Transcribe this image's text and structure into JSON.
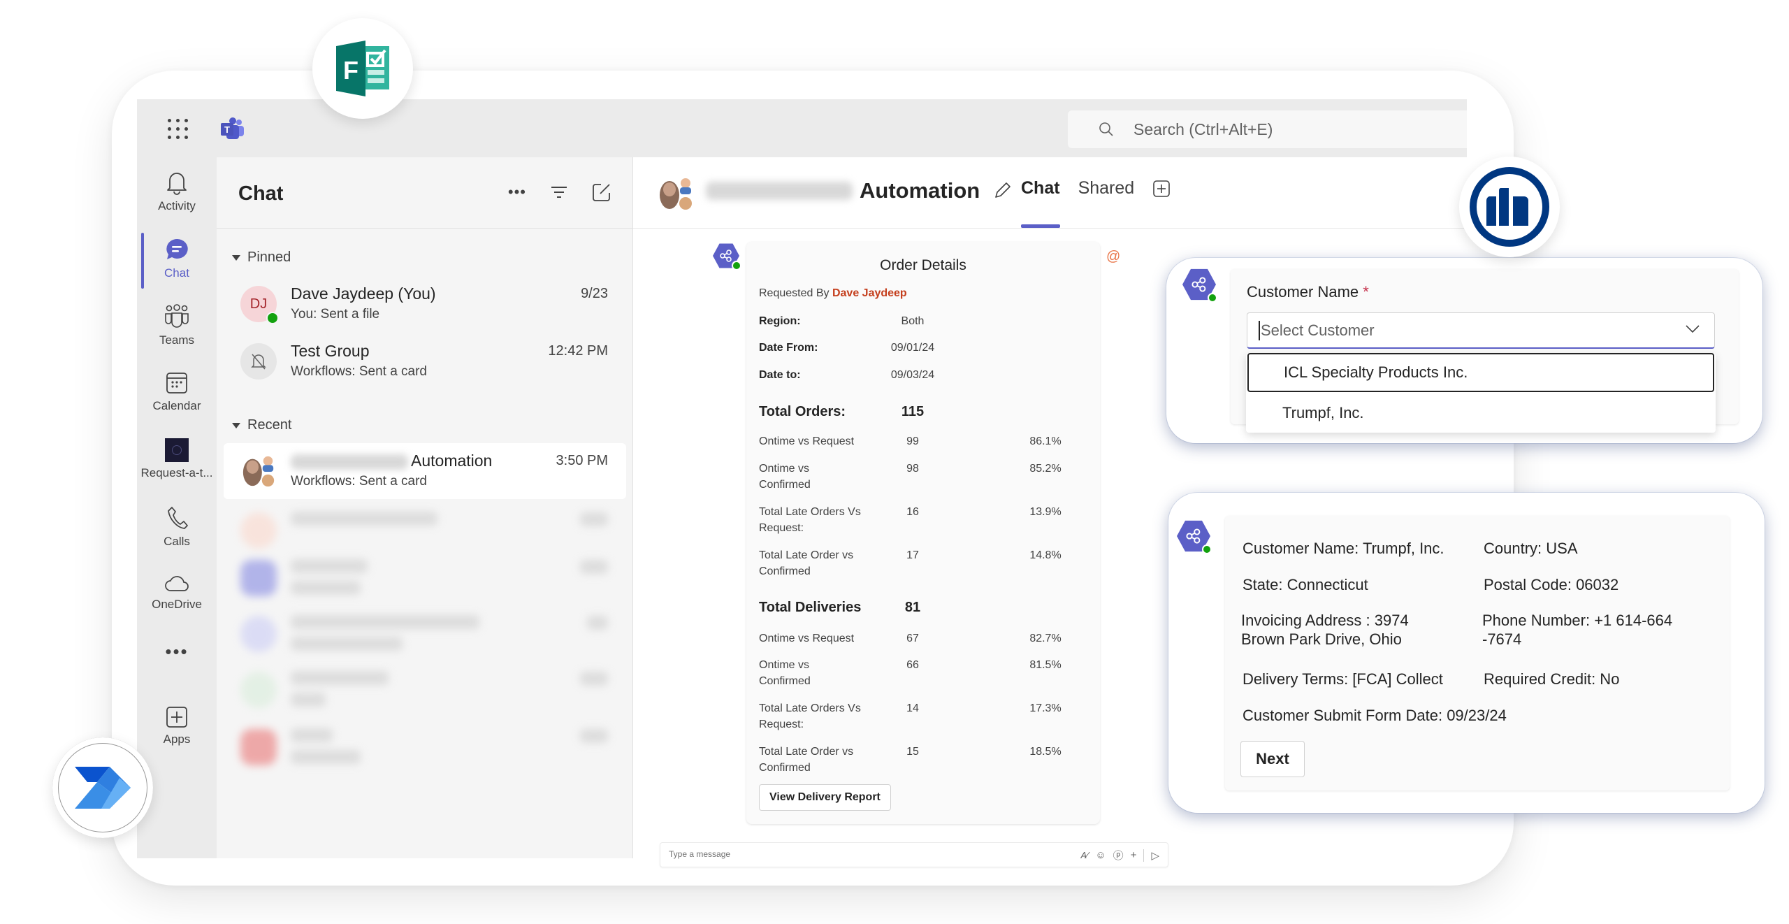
{
  "topbar": {
    "search_placeholder": "Search (Ctrl+Alt+E)"
  },
  "rail": {
    "items": [
      {
        "label": "Activity",
        "icon": "bell-icon"
      },
      {
        "label": "Chat",
        "icon": "chat-icon",
        "active": true
      },
      {
        "label": "Teams",
        "icon": "teams-icon"
      },
      {
        "label": "Calendar",
        "icon": "calendar-icon"
      },
      {
        "label": "Request-a-t...",
        "icon": "app-tile-icon"
      },
      {
        "label": "Calls",
        "icon": "phone-icon"
      },
      {
        "label": "OneDrive",
        "icon": "cloud-icon"
      },
      {
        "label": "Apps",
        "icon": "add-app-icon"
      }
    ]
  },
  "chat_list": {
    "title": "Chat",
    "sections": {
      "pinned": "Pinned",
      "recent": "Recent"
    },
    "pinned": [
      {
        "name": "Dave Jaydeep (You)",
        "preview": "You: Sent a file",
        "time": "9/23",
        "initials": "DJ"
      },
      {
        "name": "Test Group",
        "preview": "Workflows: Sent a card",
        "time": "12:42 PM"
      }
    ],
    "recent": [
      {
        "name_suffix": "Automation",
        "preview": "Workflows: Sent a card",
        "time": "3:50 PM",
        "selected": true
      }
    ]
  },
  "conversation": {
    "title_suffix": "Automation",
    "tabs": [
      "Chat",
      "Shared"
    ],
    "active_tab": "Chat",
    "compose_placeholder": "Type a message"
  },
  "order_card": {
    "title": "Order Details",
    "requested_by_label": "Requested By",
    "requested_by": "Dave Jaydeep",
    "fields": [
      {
        "label": "Region:",
        "value": "Both"
      },
      {
        "label": "Date From:",
        "value": "09/01/24"
      },
      {
        "label": "Date to:",
        "value": "09/03/24"
      }
    ],
    "orders": {
      "label": "Total Orders:",
      "total": "115",
      "rows": [
        {
          "label": "Ontime vs Request",
          "count": "99",
          "pct": "86.1%"
        },
        {
          "label": "Ontime vs Confirmed",
          "count": "98",
          "pct": "85.2%"
        },
        {
          "label": "Total Late Orders Vs Request:",
          "count": "16",
          "pct": "13.9%"
        },
        {
          "label": "Total Late Order vs Confirmed",
          "count": "17",
          "pct": "14.8%"
        }
      ]
    },
    "deliveries": {
      "label": "Total Deliveries",
      "total": "81",
      "rows": [
        {
          "label": "Ontime vs Request",
          "count": "67",
          "pct": "82.7%"
        },
        {
          "label": "Ontime vs Confirmed",
          "count": "66",
          "pct": "81.5%"
        },
        {
          "label": "Total Late Orders Vs Request:",
          "count": "14",
          "pct": "17.3%"
        },
        {
          "label": "Total Late Order vs Confirmed",
          "count": "15",
          "pct": "18.5%"
        }
      ]
    },
    "button": "View Delivery Report"
  },
  "customer_card": {
    "label": "Customer Name",
    "required_mark": "*",
    "placeholder": "Select Customer",
    "options": [
      "ICL Specialty Products Inc.",
      "Trumpf, Inc."
    ],
    "focused_option": "ICL Specialty Products Inc."
  },
  "details_card": {
    "customer_name": "Customer Name: Trumpf, Inc.",
    "country": "Country: USA",
    "state": "State: Connecticut",
    "postal_code": "Postal Code: 06032",
    "invoicing_address": "Invoicing Address : 3974 Brown Park Drive, Ohio",
    "phone": "Phone Number: +1 614-664 -7674",
    "delivery_terms": "Delivery Terms: [FCA] Collect",
    "required_credit": "Required Credit: No",
    "submit_date": "Customer Submit Form Date: 09/23/24",
    "button": "Next"
  },
  "colors": {
    "teams_accent": "#5b5fc7",
    "requester_name": "#c43e1c",
    "presence_available": "#13a10e",
    "forms_green": "#077568",
    "allianz_blue": "#003781",
    "power_automate_blue": "#2f7fe0"
  },
  "badges": [
    "microsoft-forms-logo",
    "allianz-logo",
    "power-automate-logo"
  ]
}
